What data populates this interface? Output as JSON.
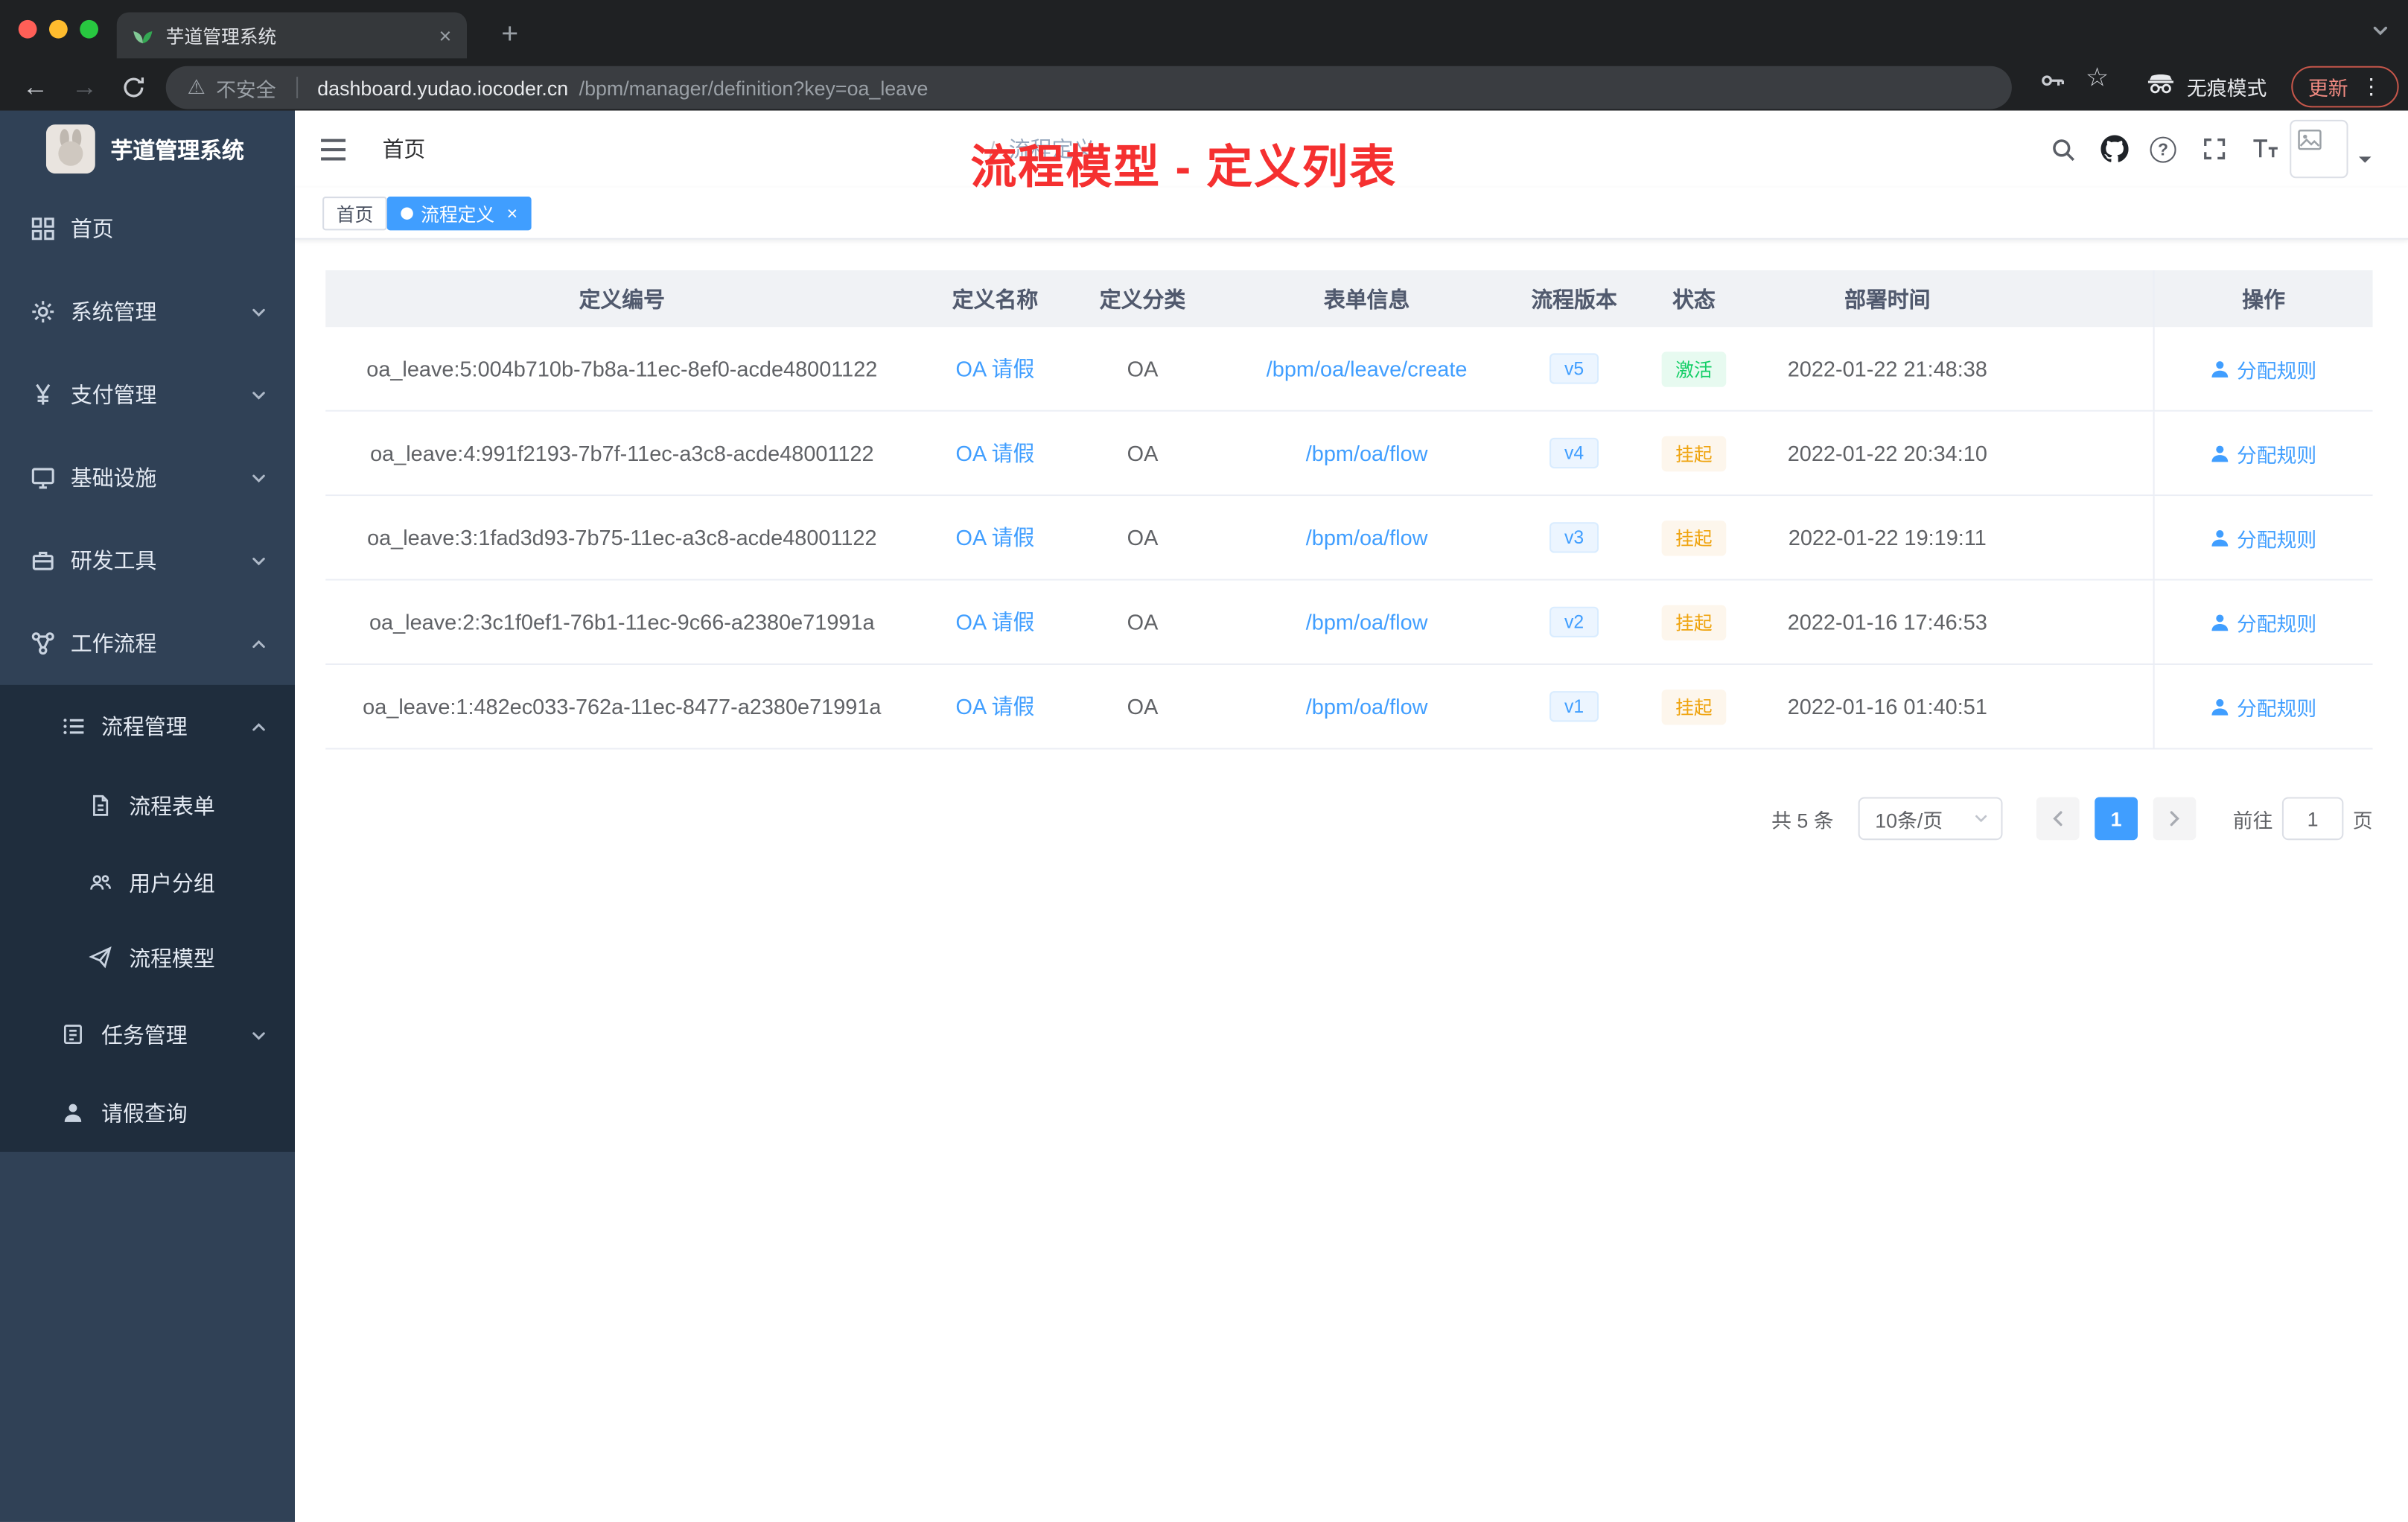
{
  "colors": {
    "accent": "#409eff",
    "success": "#13ce66",
    "warning": "#efa30d",
    "annotation_red": "#f53030",
    "sidebar_bg": "#304156",
    "submenu_bg": "#1f2d3d"
  },
  "icons": {
    "close": "×",
    "plus": "+",
    "back": "←",
    "forward": "→",
    "star": "☆",
    "warning": "⚠",
    "kebab": "⋮",
    "help": "?",
    "breadcrumb_separator": "/",
    "tag_close": "×"
  },
  "browser": {
    "tab": {
      "title": "芋道管理系统"
    },
    "address": {
      "security": "不安全",
      "domain": "dashboard.yudao.iocoder.cn",
      "path": "/bpm/manager/definition?key=oa_leave"
    },
    "incognito_label": "无痕模式",
    "update_label": "更新"
  },
  "sidebar": {
    "logo_title": "芋道管理系统",
    "items": [
      {
        "label": "首页"
      },
      {
        "label": "系统管理"
      },
      {
        "label": "支付管理"
      },
      {
        "label": "基础设施"
      },
      {
        "label": "研发工具"
      },
      {
        "label": "工作流程"
      },
      {
        "label": "流程管理"
      },
      {
        "label": "流程表单"
      },
      {
        "label": "用户分组"
      },
      {
        "label": "流程模型"
      },
      {
        "label": "任务管理"
      },
      {
        "label": "请假查询"
      }
    ]
  },
  "header": {
    "breadcrumb": [
      "首页",
      "流程定义"
    ],
    "annotation": "流程模型 - 定义列表"
  },
  "tags": {
    "items": [
      {
        "label": "首页"
      },
      {
        "label": "流程定义"
      }
    ]
  },
  "table": {
    "columns": [
      "定义编号",
      "定义名称",
      "定义分类",
      "表单信息",
      "流程版本",
      "状态",
      "部署时间",
      "操作"
    ],
    "rows": [
      {
        "id": "oa_leave:5:004b710b-7b8a-11ec-8ef0-acde48001122",
        "name": "OA 请假",
        "category": "OA",
        "form": "/bpm/oa/leave/create",
        "version": "v5",
        "status": "激活",
        "deploy_time": "2022-01-22 21:48:38",
        "action": "分配规则"
      },
      {
        "id": "oa_leave:4:991f2193-7b7f-11ec-a3c8-acde48001122",
        "name": "OA 请假",
        "category": "OA",
        "form": "/bpm/oa/flow",
        "version": "v4",
        "status": "挂起",
        "deploy_time": "2022-01-22 20:34:10",
        "action": "分配规则"
      },
      {
        "id": "oa_leave:3:1fad3d93-7b75-11ec-a3c8-acde48001122",
        "name": "OA 请假",
        "category": "OA",
        "form": "/bpm/oa/flow",
        "version": "v3",
        "status": "挂起",
        "deploy_time": "2022-01-22 19:19:11",
        "action": "分配规则"
      },
      {
        "id": "oa_leave:2:3c1f0ef1-76b1-11ec-9c66-a2380e71991a",
        "name": "OA 请假",
        "category": "OA",
        "form": "/bpm/oa/flow",
        "version": "v2",
        "status": "挂起",
        "deploy_time": "2022-01-16 17:46:53",
        "action": "分配规则"
      },
      {
        "id": "oa_leave:1:482ec033-762a-11ec-8477-a2380e71991a",
        "name": "OA 请假",
        "category": "OA",
        "form": "/bpm/oa/flow",
        "version": "v1",
        "status": "挂起",
        "deploy_time": "2022-01-16 01:40:51",
        "action": "分配规则"
      }
    ]
  },
  "pagination": {
    "total_label": "共 5 条",
    "page_size_label": "10条/页",
    "current_page": "1",
    "goto_label": "前往",
    "goto_value": "1",
    "goto_suffix": "页"
  }
}
